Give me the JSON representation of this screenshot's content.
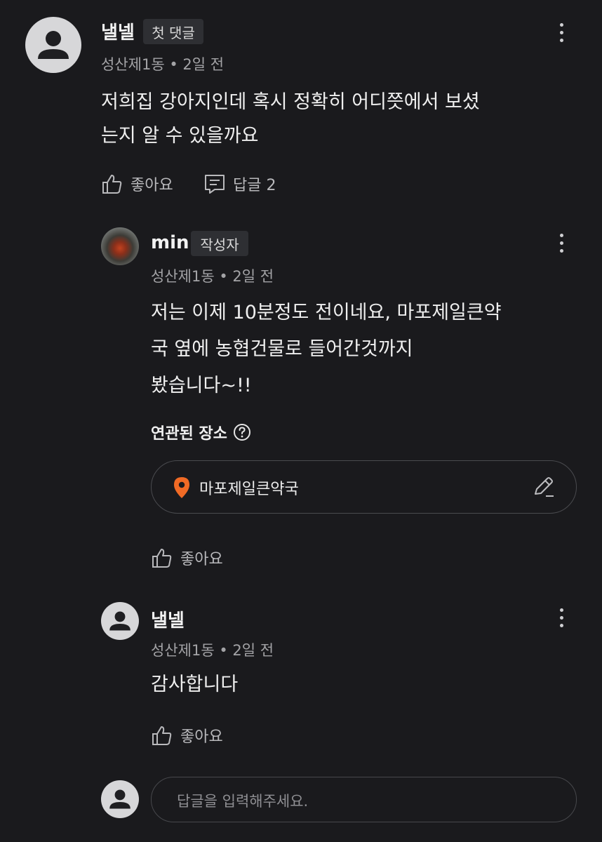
{
  "comment": {
    "author": "낼넬",
    "badge": "첫 댓글",
    "meta": "성산제1동 • 2일 전",
    "text": "저희집 강아지인데 혹시 정확히 어디쯧에서 보셨\n는지 알 수 있을까요",
    "like_label": "좋아요",
    "reply_label": "답글 2"
  },
  "replies": [
    {
      "author": "min",
      "badge": "작성자",
      "meta": "성산제1동 • 2일 전",
      "text": "저는 이제 10분정도 전이네요, 마포제일큰약\n국 옆에 농협건물로 들어간것까지\n봤습니다~!!",
      "related_place_title": "연관된 장소",
      "place_name": "마포제일큰약국",
      "like_label": "좋아요"
    },
    {
      "author": "낼넬",
      "meta": "성산제1동 • 2일 전",
      "text": "감사합니다",
      "like_label": "좋아요"
    }
  ],
  "reply_input": {
    "placeholder": "답글을 입력해주세요."
  },
  "colors": {
    "background": "#1a1a1d",
    "pin": "#f06a25",
    "badge_bg": "#2e2f33"
  }
}
